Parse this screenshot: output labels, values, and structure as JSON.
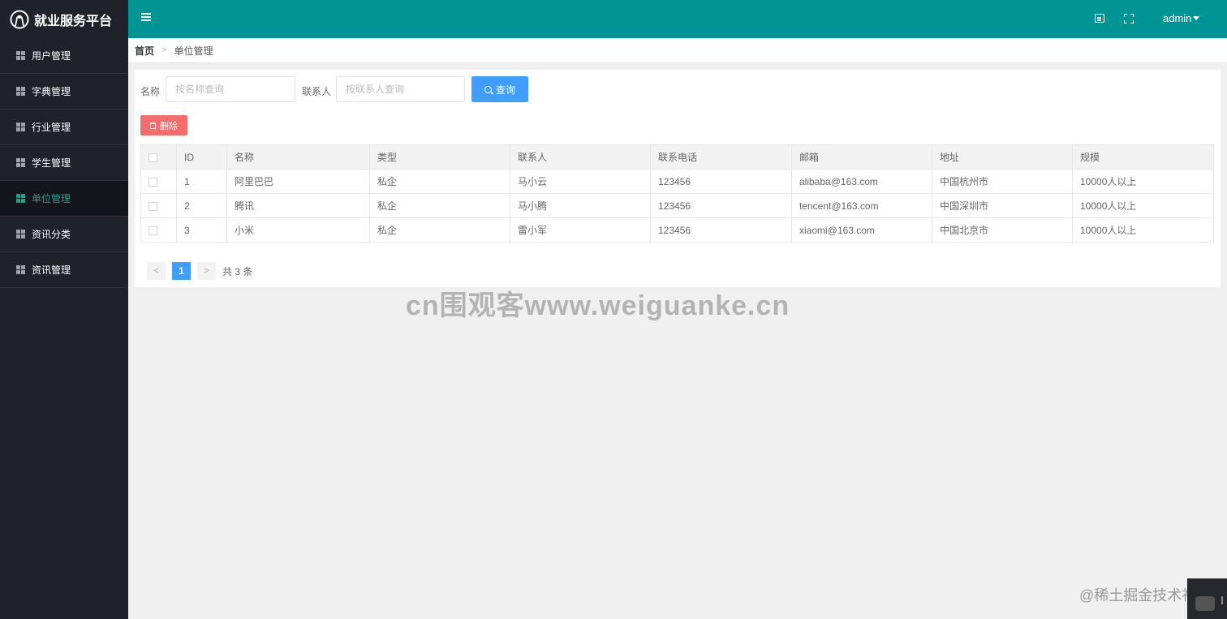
{
  "app": {
    "title": "就业服务平台"
  },
  "sidebar": {
    "items": [
      {
        "label": "用户管理",
        "active": false
      },
      {
        "label": "字典管理",
        "active": false
      },
      {
        "label": "行业管理",
        "active": false
      },
      {
        "label": "学生管理",
        "active": false
      },
      {
        "label": "单位管理",
        "active": true
      },
      {
        "label": "资讯分类",
        "active": false
      },
      {
        "label": "资讯管理",
        "active": false
      }
    ]
  },
  "header": {
    "user": "admin"
  },
  "breadcrumb": {
    "home": "首页",
    "current": "单位管理"
  },
  "search": {
    "name_label": "名称",
    "name_placeholder": "按名称查询",
    "contact_label": "联系人",
    "contact_placeholder": "按联系人查询",
    "button_label": "查询"
  },
  "toolbar": {
    "delete_label": "删除"
  },
  "table": {
    "columns": [
      "ID",
      "名称",
      "类型",
      "联系人",
      "联系电话",
      "邮箱",
      "地址",
      "规模"
    ],
    "rows": [
      [
        "1",
        "阿里巴巴",
        "私企",
        "马小云",
        "123456",
        "alibaba@163.com",
        "中国杭州市",
        "10000人以上"
      ],
      [
        "2",
        "腾讯",
        "私企",
        "马小腾",
        "123456",
        "tencent@163.com",
        "中国深圳市",
        "10000人以上"
      ],
      [
        "3",
        "小米",
        "私企",
        "雷小军",
        "123456",
        "xiaomi@163.com",
        "中国北京市",
        "10000人以上"
      ]
    ]
  },
  "pagination": {
    "current": "1",
    "total_text": "共 3 条"
  },
  "watermarks": {
    "center": "cn围观客www.weiguanke.cn",
    "corner": "@稀土掘金技术社区"
  },
  "colors": {
    "header": "#009494",
    "sidebar": "#20222a",
    "active": "#17a589",
    "primary": "#409eff",
    "danger": "#f56c6c"
  }
}
